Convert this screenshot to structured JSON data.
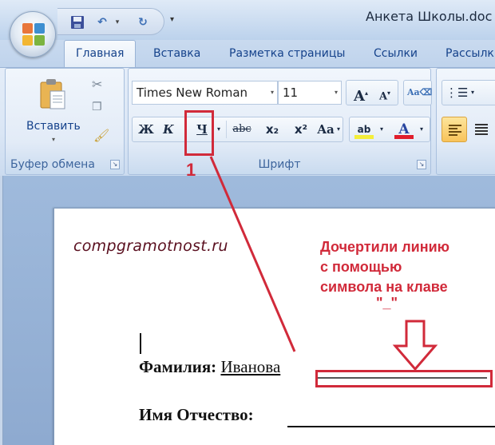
{
  "window": {
    "title": "Анкета Школы.doc"
  },
  "quick_access": {
    "save": "save-icon",
    "undo": "undo-icon",
    "undo_dropdown": "▾",
    "redo": "redo-icon",
    "customize": "▾"
  },
  "tabs": [
    {
      "label": "Главная",
      "active": true
    },
    {
      "label": "Вставка",
      "active": false
    },
    {
      "label": "Разметка страницы",
      "active": false
    },
    {
      "label": "Ссылки",
      "active": false
    },
    {
      "label": "Рассылки",
      "active": false
    }
  ],
  "ribbon": {
    "clipboard": {
      "label": "Буфер обмена",
      "paste_label": "Вставить",
      "paste_dropdown": "▾"
    },
    "font": {
      "label": "Шрифт",
      "font_name": "Times New Roman",
      "font_size": "11",
      "grow": "A",
      "shrink": "A",
      "bold": "Ж",
      "italic": "К",
      "underline": "Ч",
      "strikethrough": "abc",
      "subscript": "x₂",
      "superscript": "x²",
      "change_case": "Aa",
      "highlight": "ab",
      "font_color": "A",
      "highlight_color": "#f4ee3a",
      "font_color_value": "#e01e2d"
    },
    "paragraph": {
      "bullets": "bullets-icon"
    }
  },
  "annotations": {
    "marker": "1",
    "color": "#d12a3a",
    "note_lines": [
      "Дочертили линию",
      "с помощью",
      "символа на клаве"
    ],
    "symbol": "\"_\""
  },
  "document": {
    "watermark": "compgramotnost.ru",
    "fields": [
      {
        "label": "Фамилия:",
        "value": "Иванова"
      },
      {
        "label": "Имя Отчество:",
        "value": ""
      }
    ]
  }
}
